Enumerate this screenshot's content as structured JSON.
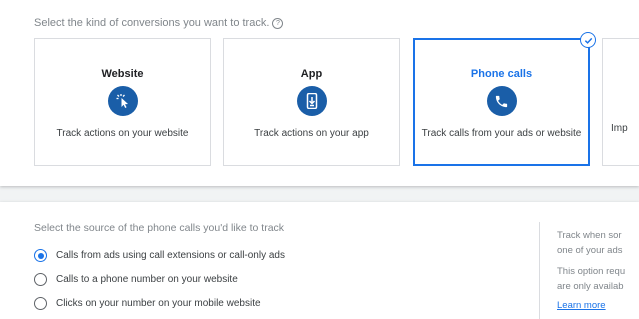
{
  "conversion_kind": {
    "prompt": "Select the kind of conversions you want to track.",
    "tiles": [
      {
        "title": "Website",
        "icon": "cursor-click-icon",
        "description": "Track actions on your website",
        "selected": false
      },
      {
        "title": "App",
        "icon": "mobile-download-icon",
        "description": "Track actions on your app",
        "selected": false
      },
      {
        "title": "Phone calls",
        "icon": "phone-icon",
        "description": "Track calls from your ads or website",
        "selected": true
      },
      {
        "title": "",
        "icon": "",
        "description": "Imp",
        "selected": false
      }
    ]
  },
  "call_source": {
    "prompt": "Select the source of the phone calls you'd like to track",
    "options": [
      {
        "label": "Calls from ads using call extensions or call-only ads",
        "selected": true
      },
      {
        "label": "Calls to a phone number on your website",
        "selected": false
      },
      {
        "label": "Clicks on your number on your mobile website",
        "selected": false
      }
    ],
    "side_info": {
      "line1": "Track when sor",
      "line2": "one of your ads",
      "line3": "This option requ",
      "line4": "are only availab",
      "learn_more": "Learn more"
    }
  },
  "colors": {
    "accent": "#1a73e8",
    "icon_bg": "#1a5ea8"
  }
}
